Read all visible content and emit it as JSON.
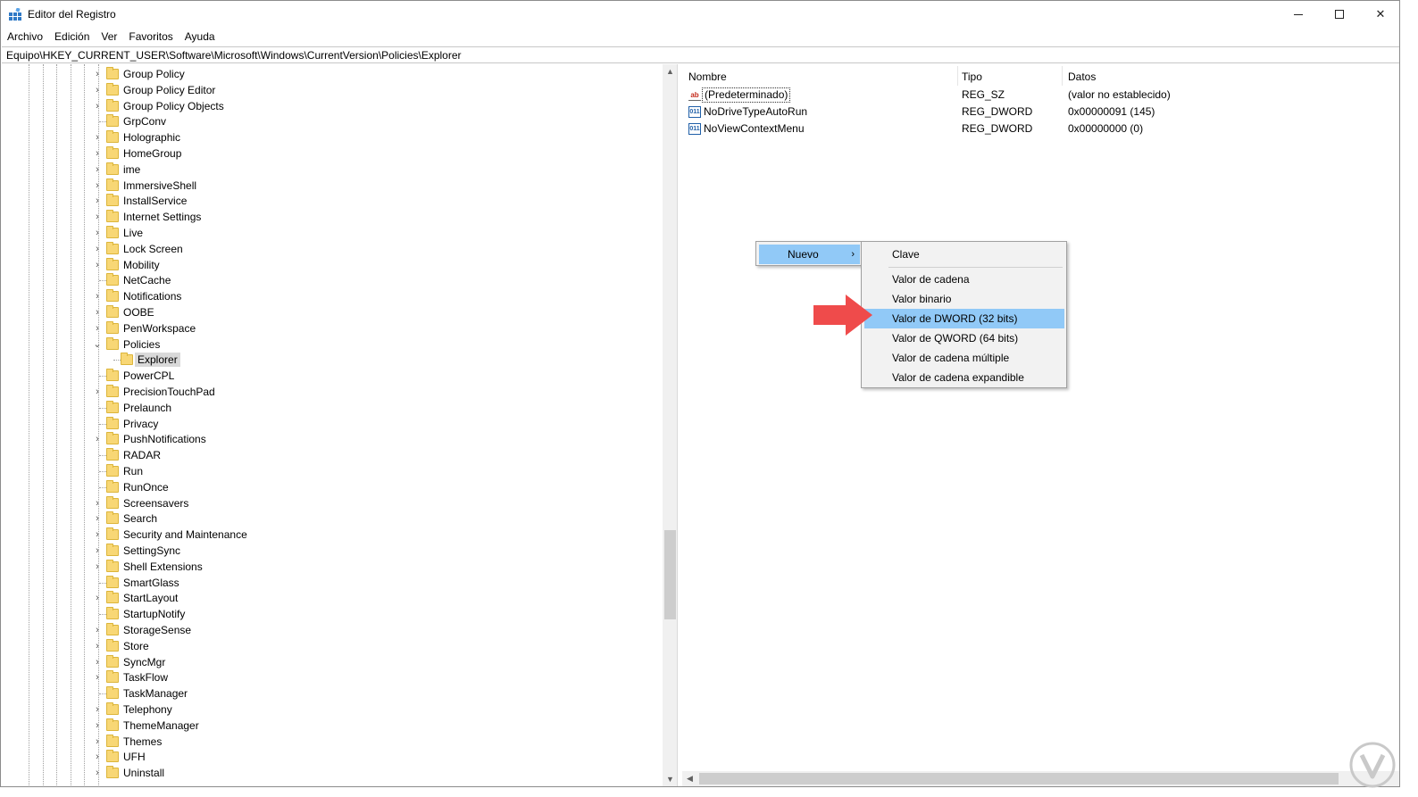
{
  "window": {
    "title": "Editor del Registro",
    "minimize_glyph": "",
    "close_glyph": "✕"
  },
  "menu": [
    "Archivo",
    "Edición",
    "Ver",
    "Favoritos",
    "Ayuda"
  ],
  "address": "Equipo\\HKEY_CURRENT_USER\\Software\\Microsoft\\Windows\\CurrentVersion\\Policies\\Explorer",
  "tree": {
    "items": [
      {
        "label": "Group Policy",
        "expander": "›"
      },
      {
        "label": "Group Policy Editor",
        "expander": "›"
      },
      {
        "label": "Group Policy Objects",
        "expander": "›"
      },
      {
        "label": "GrpConv",
        "expander": ""
      },
      {
        "label": "Holographic",
        "expander": "›"
      },
      {
        "label": "HomeGroup",
        "expander": "›"
      },
      {
        "label": "ime",
        "expander": "›"
      },
      {
        "label": "ImmersiveShell",
        "expander": "›"
      },
      {
        "label": "InstallService",
        "expander": "›"
      },
      {
        "label": "Internet Settings",
        "expander": "›"
      },
      {
        "label": "Live",
        "expander": "›"
      },
      {
        "label": "Lock Screen",
        "expander": "›"
      },
      {
        "label": "Mobility",
        "expander": "›"
      },
      {
        "label": "NetCache",
        "expander": ""
      },
      {
        "label": "Notifications",
        "expander": "›"
      },
      {
        "label": "OOBE",
        "expander": "›"
      },
      {
        "label": "PenWorkspace",
        "expander": "›"
      },
      {
        "label": "Policies",
        "expander": "⌄"
      },
      {
        "label": "Explorer",
        "expander": "",
        "child": true
      },
      {
        "label": "PowerCPL",
        "expander": ""
      },
      {
        "label": "PrecisionTouchPad",
        "expander": "›"
      },
      {
        "label": "Prelaunch",
        "expander": ""
      },
      {
        "label": "Privacy",
        "expander": ""
      },
      {
        "label": "PushNotifications",
        "expander": "›"
      },
      {
        "label": "RADAR",
        "expander": ""
      },
      {
        "label": "Run",
        "expander": ""
      },
      {
        "label": "RunOnce",
        "expander": ""
      },
      {
        "label": "Screensavers",
        "expander": "›"
      },
      {
        "label": "Search",
        "expander": "›"
      },
      {
        "label": "Security and Maintenance",
        "expander": "›"
      },
      {
        "label": "SettingSync",
        "expander": "›"
      },
      {
        "label": "Shell Extensions",
        "expander": "›"
      },
      {
        "label": "SmartGlass",
        "expander": ""
      },
      {
        "label": "StartLayout",
        "expander": "›"
      },
      {
        "label": "StartupNotify",
        "expander": ""
      },
      {
        "label": "StorageSense",
        "expander": "›"
      },
      {
        "label": "Store",
        "expander": "›"
      },
      {
        "label": "SyncMgr",
        "expander": "›"
      },
      {
        "label": "TaskFlow",
        "expander": "›"
      },
      {
        "label": "TaskManager",
        "expander": ""
      },
      {
        "label": "Telephony",
        "expander": "›"
      },
      {
        "label": "ThemeManager",
        "expander": "›"
      },
      {
        "label": "Themes",
        "expander": "›"
      },
      {
        "label": "UFH",
        "expander": "›"
      },
      {
        "label": "Uninstall",
        "expander": "›"
      }
    ]
  },
  "values": {
    "headers": {
      "name": "Nombre",
      "type": "Tipo",
      "data": "Datos"
    },
    "rows": [
      {
        "icon": "string-value-icon",
        "icon_text": "ab",
        "name": "(Predeterminado)",
        "type": "REG_SZ",
        "data": "(valor no establecido)"
      },
      {
        "icon": "dword-value-icon",
        "icon_text": "011",
        "name": "NoDriveTypeAutoRun",
        "type": "REG_DWORD",
        "data": "0x00000091 (145)"
      },
      {
        "icon": "dword-value-icon",
        "icon_text": "011",
        "name": "NoViewContextMenu",
        "type": "REG_DWORD",
        "data": "0x00000000 (0)"
      }
    ]
  },
  "context_menu": {
    "main_label": "Nuevo",
    "chevron": "›",
    "submenu": [
      {
        "label": "Clave"
      },
      {
        "label": "Valor de cadena"
      },
      {
        "label": "Valor binario"
      },
      {
        "label": "Valor de DWORD (32 bits)",
        "highlighted": true
      },
      {
        "label": "Valor de QWORD (64 bits)"
      },
      {
        "label": "Valor de cadena múltiple"
      },
      {
        "label": "Valor de cadena expandible"
      }
    ]
  },
  "colors": {
    "highlight": "#91c9f7",
    "arrow": "#ef4b4b",
    "folder": "#f8d775"
  }
}
